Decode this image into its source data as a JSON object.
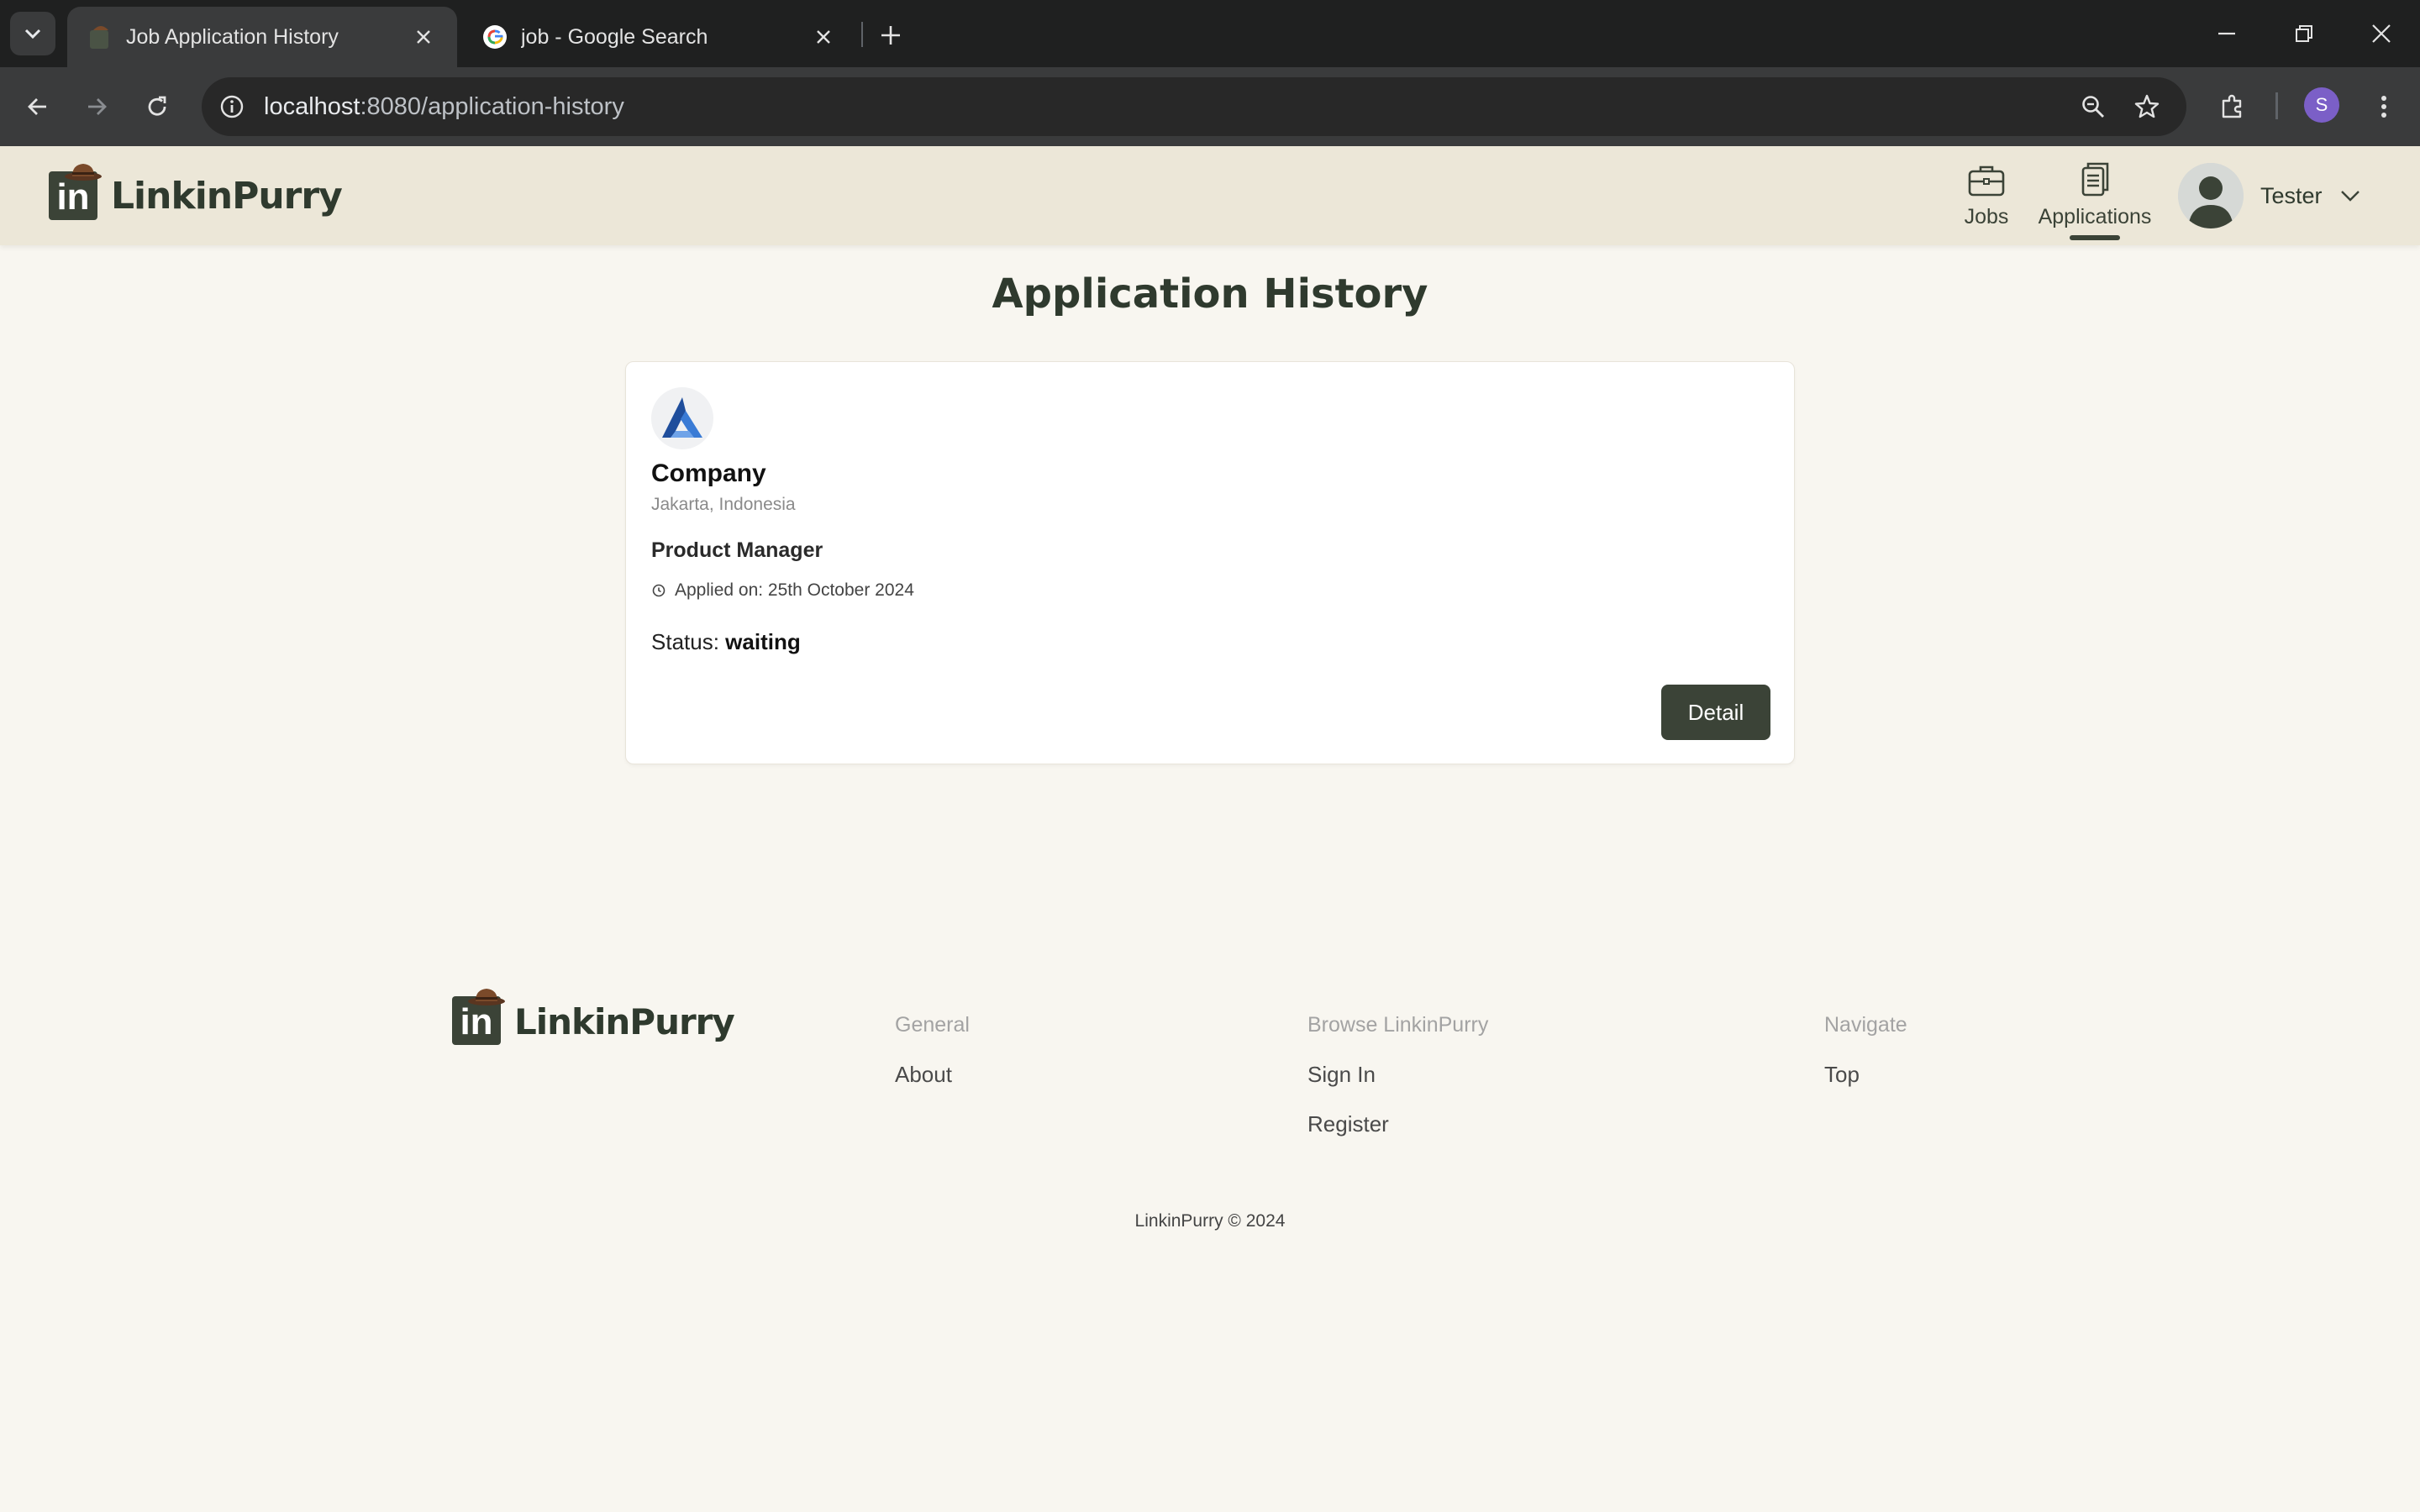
{
  "browser": {
    "tabs": [
      {
        "title": "Job Application History",
        "active": true
      },
      {
        "title": "job - Google Search",
        "active": false
      }
    ],
    "url_host": "localhost",
    "url_rest": ":8080/application-history",
    "profile_initial": "S"
  },
  "header": {
    "brand": "LinkinPurry",
    "brand_mark": "in",
    "nav": [
      {
        "label": "Jobs",
        "icon": "briefcase-icon"
      },
      {
        "label": "Applications",
        "icon": "documents-icon",
        "active": true
      }
    ],
    "user": {
      "name": "Tester"
    }
  },
  "main": {
    "title": "Application History",
    "applications": [
      {
        "company": "Company",
        "location": "Jakarta, Indonesia",
        "position": "Product Manager",
        "applied_on": "Applied on: 25th October 2024",
        "status_label": "Status:",
        "status": "waiting",
        "detail_label": "Detail"
      }
    ]
  },
  "footer": {
    "brand": "LinkinPurry",
    "columns": [
      {
        "heading": "General",
        "links": [
          "About"
        ]
      },
      {
        "heading": "Browse LinkinPurry",
        "links": [
          "Sign In",
          "Register"
        ]
      },
      {
        "heading": "Navigate",
        "links": [
          "Top"
        ]
      }
    ],
    "copyright": "LinkinPurry © 2024"
  },
  "colors": {
    "brand_dark": "#3b4337",
    "header_bg": "#ece7d8",
    "page_bg": "#f8f6f0"
  }
}
